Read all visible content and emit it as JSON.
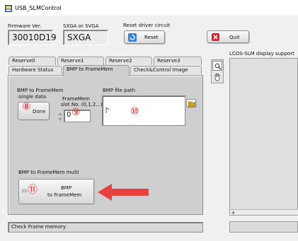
{
  "window": {
    "title": "USB_SLMControl"
  },
  "header": {
    "firmware_label": "Firmware Ver.",
    "firmware_value": "30010D19",
    "sxga_label": "SXGA or SVGA",
    "sxga_value": "SXGA",
    "reset_label": "Reset driver circuit",
    "reset_button": "Reset",
    "quit_button": "Quit"
  },
  "tabs": {
    "row_top": [
      "Reserve0",
      "Reserve1",
      "Reserve2",
      "Reserve3"
    ],
    "row_bottom": [
      "Hardware Status",
      "BMP to FrameMem",
      "Check&Control Image"
    ],
    "active": "BMP to FrameMem"
  },
  "bmp_panel": {
    "bmp_to_framemem_label": "BMP to FrameMem",
    "single_data_label": ":single data",
    "done_button": "Done",
    "framemem_slot_label_line1": "FrameMem",
    "framemem_slot_label_line2": "slot No. (0,1,2...)",
    "slot_value": "0",
    "bmp_file_path_label": "BMP file path",
    "multi_label": "BMP to FrameMem multi",
    "multi_button_line1": "BMP",
    "multi_button_line2": "to FrameMem",
    "marker_8": "⑧",
    "marker_9": "⑨",
    "marker_10": "⑩",
    "marker_11": "⑪"
  },
  "right": {
    "display_support_label": "LCOS-SLM display support"
  },
  "status_bar": {
    "text": "Check Frame memory"
  },
  "colors": {
    "annotation_red": "#e52222",
    "quit_red": "#d7202a",
    "reset_blue": "#3a7fd8"
  }
}
